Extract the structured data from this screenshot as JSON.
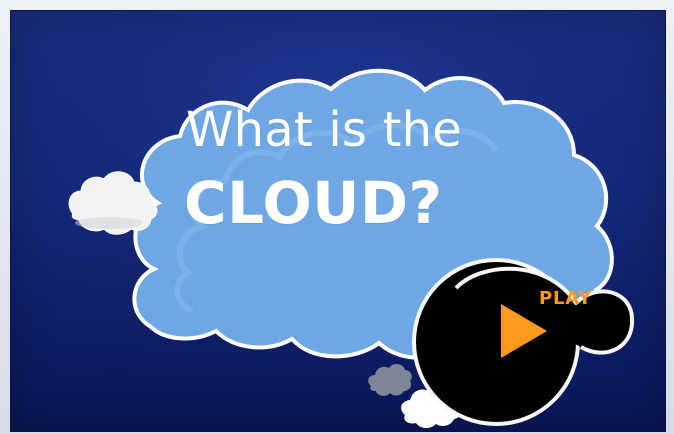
{
  "colors": {
    "background": "#1a2f83",
    "cloud_fill": "#6fa7e4",
    "cloud_outline": "#ffffff",
    "play_button": "#000000",
    "play_accent": "#ff9a1d",
    "small_cloud": "#f2f2f2"
  },
  "scene": {
    "title_line1": "What is the",
    "title_line2": "CLOUD?",
    "play_label": "PLAY"
  },
  "icons": {
    "main_cloud": "cloud-icon",
    "small_cloud": "small-cloud-icon",
    "play_button": "play-icon"
  }
}
